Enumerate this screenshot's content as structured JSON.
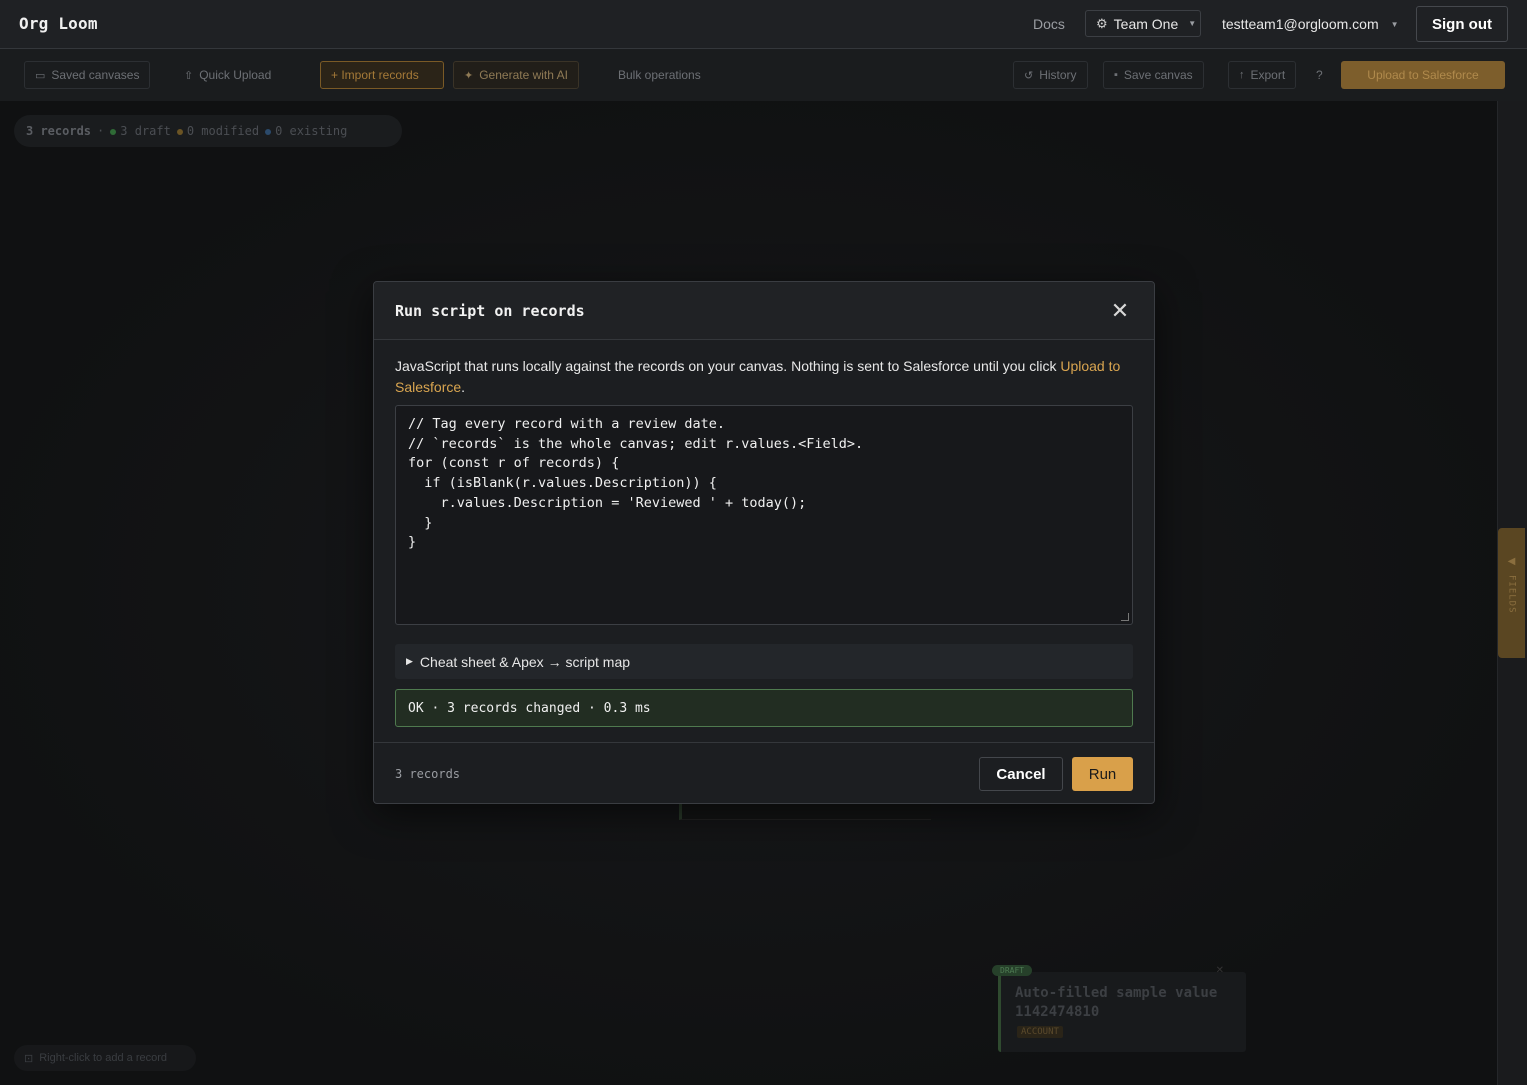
{
  "nav": {
    "brand": "Org Loom",
    "docs": "Docs",
    "team": "Team One",
    "email": "testteam1@orgloom.com",
    "sign_out": "Sign out"
  },
  "toolbar": {
    "saved_canvases": "Saved canvases",
    "quick_upload": "Quick Upload",
    "import_records": "+ Import records",
    "generate_ai": "Generate with AI",
    "bulk_operations": "Bulk operations",
    "history": "History",
    "save_canvas": "Save canvas",
    "export": "Export",
    "help": "?",
    "upload_salesforce": "Upload to Salesforce"
  },
  "stats": {
    "records": "3 records",
    "draft": "3 draft",
    "modified": "0 modified",
    "existing": "0 existing",
    "colors": {
      "draft": "#2f6b36",
      "modified": "#6b5424",
      "existing": "#2b4a6b"
    }
  },
  "canvas": {
    "hint": "Right-click to add a record",
    "node": {
      "badge": "DRAFT",
      "title_line1": "Auto-filled sample value",
      "title_line2": "1142474810",
      "tag": "ACCOUNT"
    },
    "side_panel": "FIELDS"
  },
  "modal": {
    "title": "Run script on records",
    "desc_prefix": "JavaScript that runs locally against the records on your canvas. Nothing is sent to Salesforce until you click ",
    "desc_link": "Upload to Salesforce",
    "desc_suffix": ".",
    "code": "// Tag every record with a review date.\n// `records` is the whole canvas; edit r.values.<Field>.\nfor (const r of records) {\n  if (isBlank(r.values.Description)) {\n    r.values.Description = 'Reviewed ' + today();\n  }\n}",
    "cheat_sheet": "Cheat sheet & Apex → script map",
    "result": "OK · 3 records changed · 0.3 ms",
    "record_count": "3 records",
    "cancel": "Cancel",
    "run": "Run"
  },
  "colors": {
    "accent": "#d9a04a",
    "success_border": "#4f7a4f",
    "link": "#d9a550"
  }
}
